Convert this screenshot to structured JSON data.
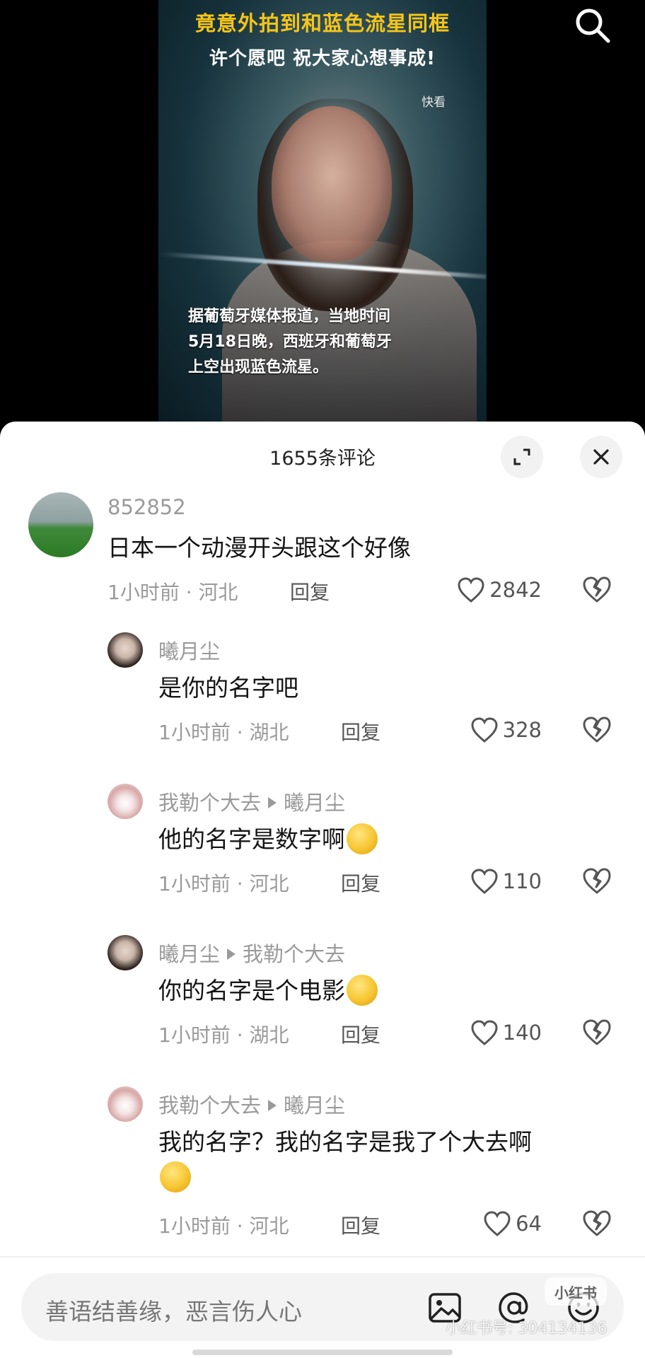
{
  "video": {
    "headline": "竟意外拍到和蓝色流星同框",
    "subheadline": "许个愿吧 祝大家心想事成!",
    "source_watermark": "快看",
    "caption_lines": [
      "据葡萄牙媒体报道，当地时间",
      "5月18日晚，西班牙和葡萄牙",
      "上空出现蓝色流星。"
    ],
    "search_icon": "search-icon"
  },
  "sheet": {
    "title": "1655条评论",
    "expand_icon": "expand-icon",
    "close_icon": "close-icon"
  },
  "comments": [
    {
      "user": "852852",
      "text": "日本一个动漫开头跟这个好像",
      "meta": "1小时前 · 河北",
      "reply": "回复",
      "likes": "2842"
    },
    {
      "user": "曦月尘",
      "text": "是你的名字吧",
      "meta": "1小时前 · 湖北",
      "reply": "回复",
      "likes": "328"
    },
    {
      "user": "我勒个大去",
      "reply_to": "曦月尘",
      "text": "他的名字是数字啊",
      "emoji": "flushed-face-emoji",
      "meta": "1小时前 · 河北",
      "reply": "回复",
      "likes": "110"
    },
    {
      "user": "曦月尘",
      "reply_to": "我勒个大去",
      "text": "你的名字是个电影",
      "emoji": "flushed-face-emoji",
      "meta": "1小时前 · 湖北",
      "reply": "回复",
      "likes": "140"
    },
    {
      "user": "我勒个大去",
      "reply_to": "曦月尘",
      "text": "我的名字？我的名字是我了个大去啊",
      "emoji": "flushed-face-emoji",
      "meta": "1小时前 · 河北",
      "reply": "回复",
      "likes": "64"
    }
  ],
  "input": {
    "placeholder": "善语结善缘，恶言伤人心",
    "icons": [
      "image-icon",
      "at-icon",
      "emoji-icon"
    ]
  },
  "watermark": {
    "badge": "小红书",
    "text": "小红书号: 304134136"
  },
  "colors": {
    "headline": "#f5c518",
    "muted": "#9a9a9a",
    "sheet_bg": "#ffffff"
  }
}
